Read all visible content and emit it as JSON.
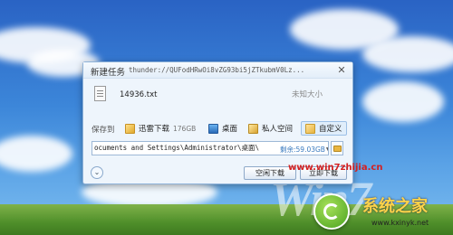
{
  "dialog": {
    "title": "新建任务",
    "url": "thunder://QUFodHRwOi8vZG93bi5jZTkubmV0Lz...",
    "close_icon": "close-icon"
  },
  "file": {
    "name": "14936.txt",
    "size": "未知大小",
    "icon": "text-file-icon"
  },
  "save": {
    "label": "保存到",
    "options": [
      {
        "label": "迅雷下载",
        "sub": "176GB",
        "icon": "xunlei-folder-icon"
      },
      {
        "label": "桌面",
        "icon": "desktop-icon"
      },
      {
        "label": "私人空间",
        "icon": "private-space-icon"
      },
      {
        "label": "自定义",
        "icon": "custom-folder-icon",
        "selected": true
      }
    ]
  },
  "path": {
    "value": "ocuments and Settings\\Administrator\\桌面\\",
    "free_space": "剩余:59.03GB",
    "browse_icon": "folder-icon"
  },
  "actions": {
    "expand_icon": "chevron-down-icon",
    "idle_download": "空闲下载",
    "download_now": "立即下载"
  },
  "watermark": {
    "site": "www.win7zhijia.cn",
    "logo_text": "系统之家",
    "url": "www.kxinyk.net",
    "brand": "Win7"
  },
  "colors": {
    "dialog_bg": "#eef5fc",
    "watermark_red": "#d42020",
    "free_space_blue": "#3a7abf"
  }
}
